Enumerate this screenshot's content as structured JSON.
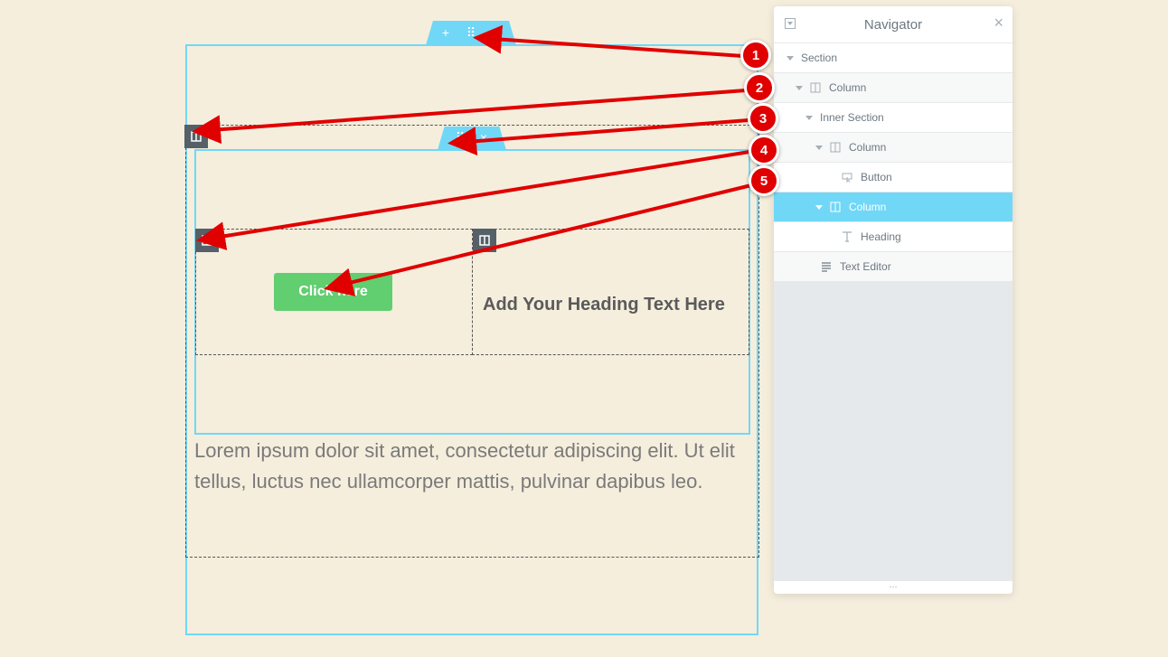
{
  "section_handle": {
    "add": "+",
    "move": "⠿",
    "close": "×"
  },
  "inner_handle": {
    "move": "⠿",
    "close": "×"
  },
  "canvas": {
    "button_label": "Click here",
    "heading": "Add Your Heading Text Here",
    "paragraph": "Lorem ipsum dolor sit amet, consectetur adipiscing elit. Ut elit tellus, luctus nec ullamcorper mattis, pulvinar dapibus leo."
  },
  "navigator": {
    "title": "Navigator",
    "close": "×",
    "footer": "...",
    "items": [
      {
        "label": "Section",
        "icon": "caret",
        "active": false
      },
      {
        "label": "Column",
        "icon": "column-icon",
        "active": false
      },
      {
        "label": "Inner Section",
        "icon": "caret",
        "active": false
      },
      {
        "label": "Column",
        "icon": "column-icon",
        "active": false
      },
      {
        "label": "Button",
        "icon": "button-icon",
        "active": false
      },
      {
        "label": "Column",
        "icon": "column-icon",
        "active": true
      },
      {
        "label": "Heading",
        "icon": "heading-icon",
        "active": false
      },
      {
        "label": "Text Editor",
        "icon": "text-editor-icon",
        "active": false
      }
    ]
  },
  "annotations": [
    "1",
    "2",
    "3",
    "4",
    "5"
  ],
  "colors": {
    "accent": "#71d7f7",
    "button": "#61ce70",
    "annotation": "#e00000",
    "background": "#f5eedd"
  }
}
